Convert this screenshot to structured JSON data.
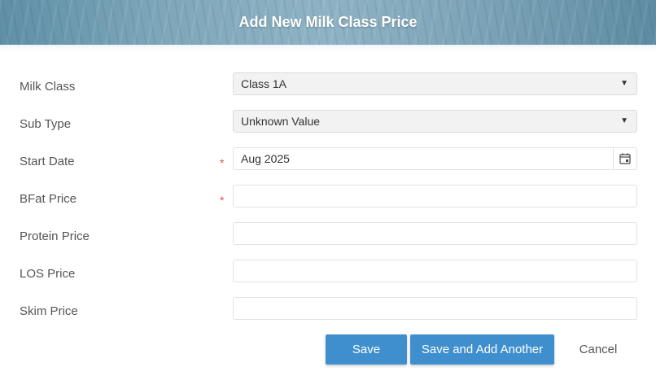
{
  "dialog": {
    "title": "Add New Milk Class Price"
  },
  "form": {
    "milk_class": {
      "label": "Milk Class",
      "value": "Class 1A"
    },
    "sub_type": {
      "label": "Sub Type",
      "value": "Unknown Value"
    },
    "start_date": {
      "label": "Start Date",
      "value": "Aug 2025",
      "required_mark": "*"
    },
    "bfat_price": {
      "label": "BFat Price",
      "value": "",
      "required_mark": "*"
    },
    "protein_price": {
      "label": "Protein Price",
      "value": ""
    },
    "los_price": {
      "label": "LOS Price",
      "value": ""
    },
    "skim_price": {
      "label": "Skim Price",
      "value": ""
    }
  },
  "actions": {
    "save_label": "Save",
    "save_add_label": "Save and Add Another",
    "cancel_label": "Cancel"
  },
  "icons": {
    "caret": "chevron-down-icon",
    "calendar": "calendar-icon"
  },
  "colors": {
    "primary_button": "#3f8fcf",
    "required": "#d9534f"
  }
}
